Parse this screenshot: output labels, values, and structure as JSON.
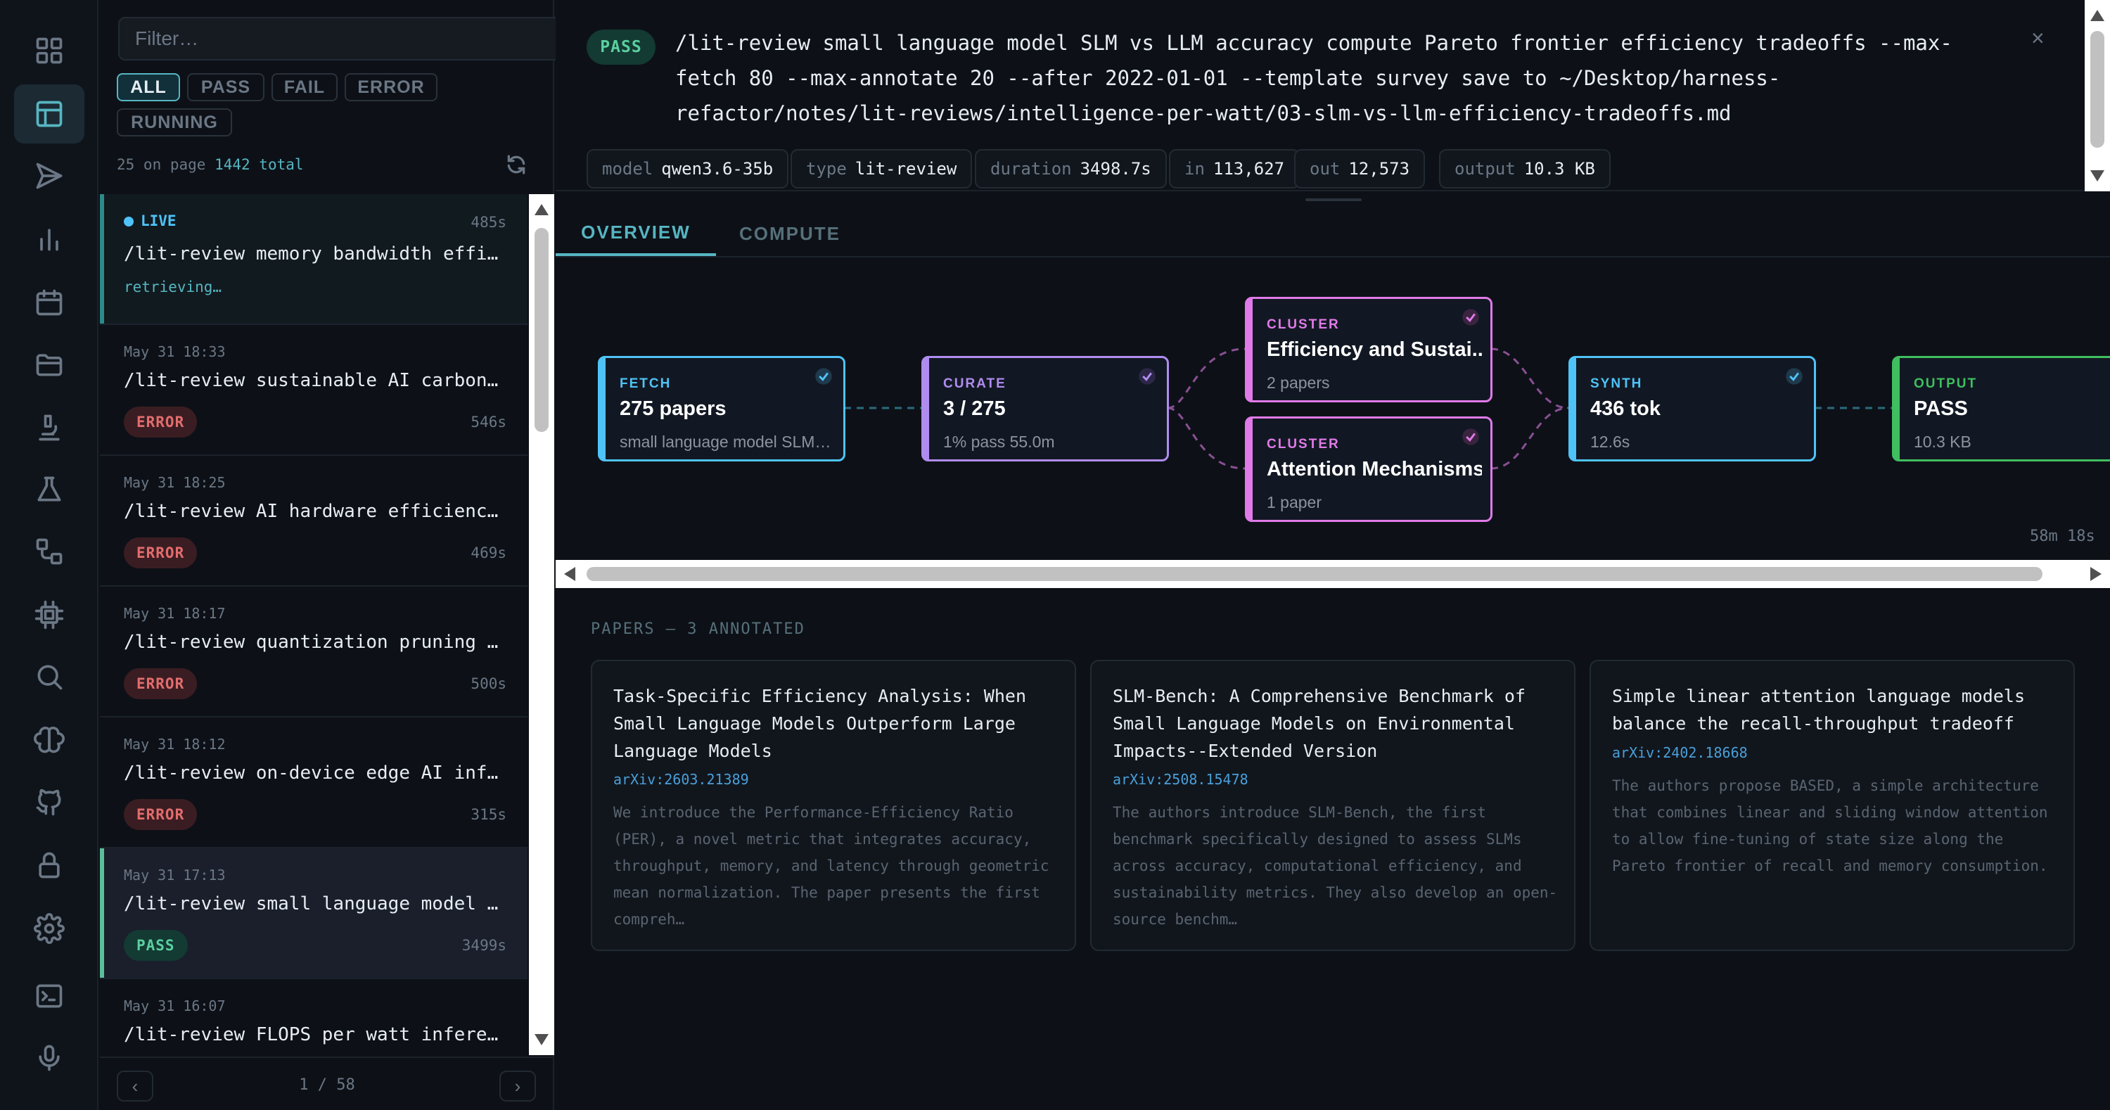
{
  "sidebar": {
    "filter_placeholder": "Filter…",
    "chips": [
      "ALL",
      "PASS",
      "FAIL",
      "ERROR",
      "RUNNING"
    ],
    "active_chip": "ALL",
    "on_page": "25 on page",
    "total": "1442 total",
    "pagination": "1 / 58",
    "prev_label": "‹",
    "next_label": "›"
  },
  "runs": [
    {
      "live_label": "LIVE",
      "duration": "485s",
      "title": "/lit-review memory bandwidth efficiency",
      "sub": "retrieving…"
    },
    {
      "date": "May 31 18:33",
      "title": "/lit-review sustainable AI carbon footprint",
      "status": "ERROR",
      "duration": "546s"
    },
    {
      "date": "May 31 18:25",
      "title": "/lit-review AI hardware efficiency GPU",
      "status": "ERROR",
      "duration": "469s"
    },
    {
      "date": "May 31 18:17",
      "title": "/lit-review quantization pruning knowledge",
      "status": "ERROR",
      "duration": "500s"
    },
    {
      "date": "May 31 18:12",
      "title": "/lit-review on-device edge AI inference",
      "status": "ERROR",
      "duration": "315s"
    },
    {
      "date": "May 31 17:13",
      "title": "/lit-review small language model SLM vs",
      "status": "PASS",
      "duration": "3499s"
    },
    {
      "date": "May 31 16:07",
      "title": "/lit-review FLOPS per watt inference e"
    }
  ],
  "detail": {
    "status": "PASS",
    "command": "/lit-review small language model SLM vs LLM accuracy compute Pareto frontier efficiency tradeoffs --max-fetch 80 --max-annotate 20 --after 2022-01-01 --template survey save to ~/Desktop/harness-refactor/notes/lit-reviews/intelligence-per-watt/03-slm-vs-llm-efficiency-tradeoffs.md",
    "close_label": "×",
    "meta": {
      "model": {
        "k": "model",
        "v": "qwen3.6-35b"
      },
      "type": {
        "k": "type",
        "v": "lit-review"
      },
      "duration": {
        "k": "duration",
        "v": "3498.7s"
      },
      "in": {
        "k": "in",
        "v": "113,627"
      },
      "out": {
        "k": "out",
        "v": "12,573"
      },
      "output": {
        "k": "output",
        "v": "10.3 KB"
      }
    },
    "tabs": [
      "OVERVIEW",
      "COMPUTE"
    ],
    "active_tab": "OVERVIEW",
    "pipeline": {
      "fetch": {
        "type": "FETCH",
        "value": "275 papers",
        "sub": "small language model SLM vs..."
      },
      "curate": {
        "type": "CURATE",
        "value": "3 / 275",
        "sub": "1% pass 55.0m"
      },
      "cluster1": {
        "type": "CLUSTER",
        "value": "Efficiency and Sustai...",
        "sub": "2 papers"
      },
      "cluster2": {
        "type": "CLUSTER",
        "value": "Attention Mechanisms ...",
        "sub": "1 paper"
      },
      "synth": {
        "type": "SYNTH",
        "value": "436 tok",
        "sub": "12.6s"
      },
      "output": {
        "type": "OUTPUT",
        "value": "PASS",
        "sub": "10.3 KB"
      },
      "elapsed": "58m 18s"
    },
    "papers_heading": "PAPERS — 3 ANNOTATED",
    "papers": [
      {
        "title": "Task-Specific Efficiency Analysis: When Small Language Models Outperform Large Language Models",
        "arxiv": "arXiv:2603.21389",
        "abstract": "We introduce the Performance-Efficiency Ratio (PER), a novel metric that integrates accuracy, throughput, memory, and latency through geometric mean normalization. The paper presents the first compreh…"
      },
      {
        "title": "SLM-Bench: A Comprehensive Benchmark of Small Language Models on Environmental Impacts--Extended Version",
        "arxiv": "arXiv:2508.15478",
        "abstract": "The authors introduce SLM-Bench, the first benchmark specifically designed to assess SLMs across accuracy, computational efficiency, and sustainability metrics. They also develop an open-source benchm…"
      },
      {
        "title": "Simple linear attention language models balance the recall-throughput tradeoff",
        "arxiv": "arXiv:2402.18668",
        "abstract": "The authors propose BASED, a simple architecture that combines linear and sliding window attention to allow fine-tuning of state size along the Pareto frontier of recall and memory consumption."
      }
    ]
  },
  "colors": {
    "accent": "#56b6c2",
    "pass": "#5bcf9f",
    "error": "#e26d6d",
    "fetch": "#4fc3f7",
    "curate": "#b08cf0",
    "cluster": "#e07ae8",
    "output": "#3fbf5f"
  },
  "icons": [
    "dashboard-icon",
    "table-icon",
    "send-icon",
    "bar-chart-icon",
    "calendar-icon",
    "folder-icon",
    "microscope-icon",
    "flask-icon",
    "workflow-icon",
    "chip-icon",
    "search-icon",
    "brain-icon",
    "git-icon",
    "lock-icon",
    "gear-icon",
    "terminal-icon",
    "microphone-icon"
  ]
}
